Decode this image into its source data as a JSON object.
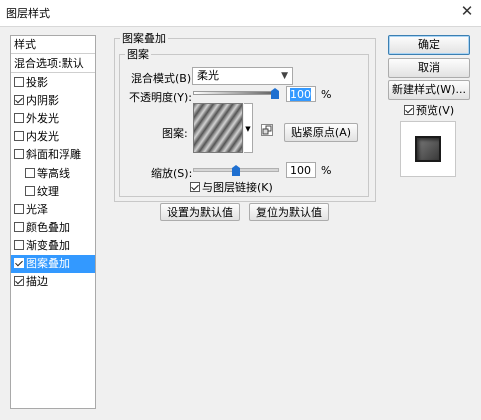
{
  "window": {
    "title": "图层样式",
    "close_glyph": "✕"
  },
  "style_list": {
    "header": "样式",
    "blend_options": "混合选项:默认",
    "items": [
      {
        "label": "投影",
        "checked": false,
        "selected": false,
        "indent": false
      },
      {
        "label": "内阴影",
        "checked": true,
        "selected": false,
        "indent": false
      },
      {
        "label": "外发光",
        "checked": false,
        "selected": false,
        "indent": false
      },
      {
        "label": "内发光",
        "checked": false,
        "selected": false,
        "indent": false
      },
      {
        "label": "斜面和浮雕",
        "checked": false,
        "selected": false,
        "indent": false
      },
      {
        "label": "等高线",
        "checked": false,
        "selected": false,
        "indent": true
      },
      {
        "label": "纹理",
        "checked": false,
        "selected": false,
        "indent": true
      },
      {
        "label": "光泽",
        "checked": false,
        "selected": false,
        "indent": false
      },
      {
        "label": "颜色叠加",
        "checked": false,
        "selected": false,
        "indent": false
      },
      {
        "label": "渐变叠加",
        "checked": false,
        "selected": false,
        "indent": false
      },
      {
        "label": "图案叠加",
        "checked": true,
        "selected": true,
        "indent": false
      },
      {
        "label": "描边",
        "checked": true,
        "selected": false,
        "indent": false
      }
    ]
  },
  "panel": {
    "outer_title": "图案叠加",
    "inner_title": "图案",
    "blend_mode_label": "混合模式(B):",
    "blend_mode_value": "柔光",
    "opacity_label": "不透明度(Y):",
    "opacity_value": "100",
    "opacity_unit": "%",
    "opacity_level": 1.0,
    "pattern_label": "图案:",
    "snap_origin_button": "贴紧原点(A)",
    "scale_label": "缩放(S):",
    "scale_value": "100",
    "scale_unit": "%",
    "scale_level": 0.5,
    "link_layer_label": "与图层链接(K)",
    "link_layer_checked": true,
    "set_default_button": "设置为默认值",
    "reset_default_button": "复位为默认值"
  },
  "right_panel": {
    "ok_button": "确定",
    "cancel_button": "取消",
    "new_style_button": "新建样式(W)...",
    "preview_label": "预览(V)",
    "preview_checked": true
  },
  "colors": {
    "selection": "#3399ff",
    "dialog_bg": "#f0f0f0",
    "slider_thumb": "#1e6fd0"
  }
}
